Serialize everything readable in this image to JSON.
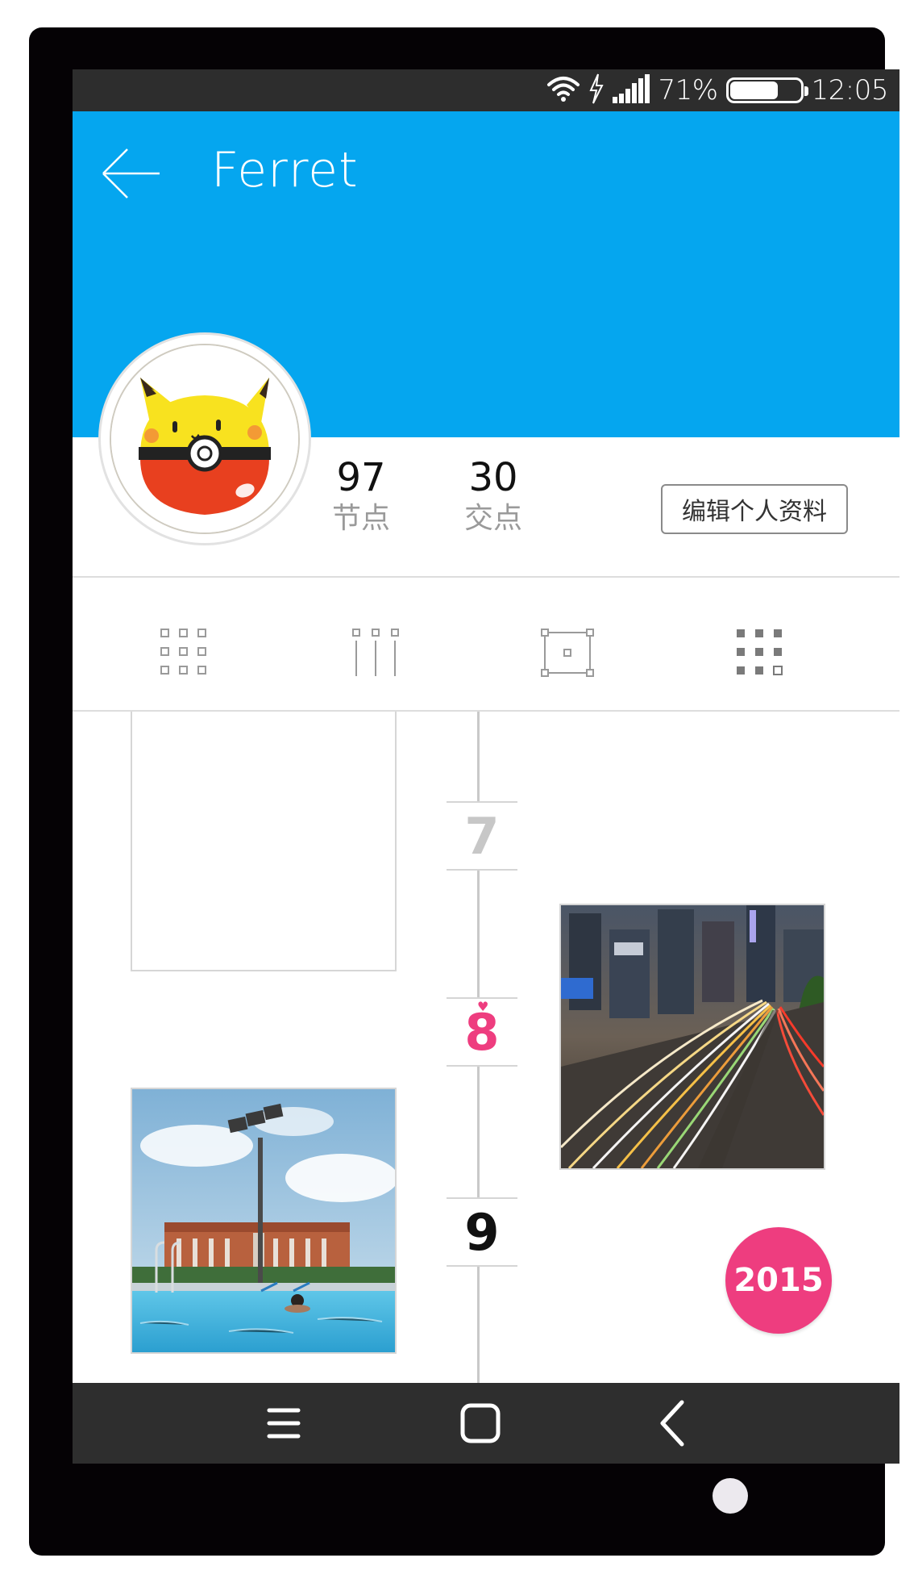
{
  "status_bar": {
    "battery_percent": "71%",
    "battery_level": 0.71,
    "time": "12:05",
    "icons": [
      "wifi-icon",
      "charging-icon",
      "signal-icon",
      "battery-icon"
    ]
  },
  "header": {
    "title": "Ferret",
    "back_icon": "arrow-left-icon",
    "color": "#05a6ef"
  },
  "profile": {
    "avatar_icon": "pikachu-pokeball-avatar",
    "stats": [
      {
        "value": "97",
        "label": "节点"
      },
      {
        "value": "30",
        "label": "交点"
      }
    ],
    "edit_button": "编辑个人资料"
  },
  "view_tabs": [
    {
      "name": "grid-3x3-icon"
    },
    {
      "name": "columns-icon"
    },
    {
      "name": "crop-frame-icon"
    },
    {
      "name": "grid-filled-icon"
    }
  ],
  "timeline": {
    "days": [
      {
        "label": "7",
        "color": "#c7c7c7",
        "active": false
      },
      {
        "label": "8",
        "color": "#ee3d7f",
        "active": true
      },
      {
        "label": "9",
        "color": "#111111",
        "active": false
      }
    ],
    "photos": [
      "blank-photo",
      "city-traffic-light-trails-photo",
      "swimming-pool-floodlight-photo"
    ]
  },
  "year_button": "2015",
  "accent_color": "#ee3d7f",
  "nav_bar": {
    "buttons": [
      "menu-icon",
      "home-icon",
      "back-icon"
    ]
  }
}
